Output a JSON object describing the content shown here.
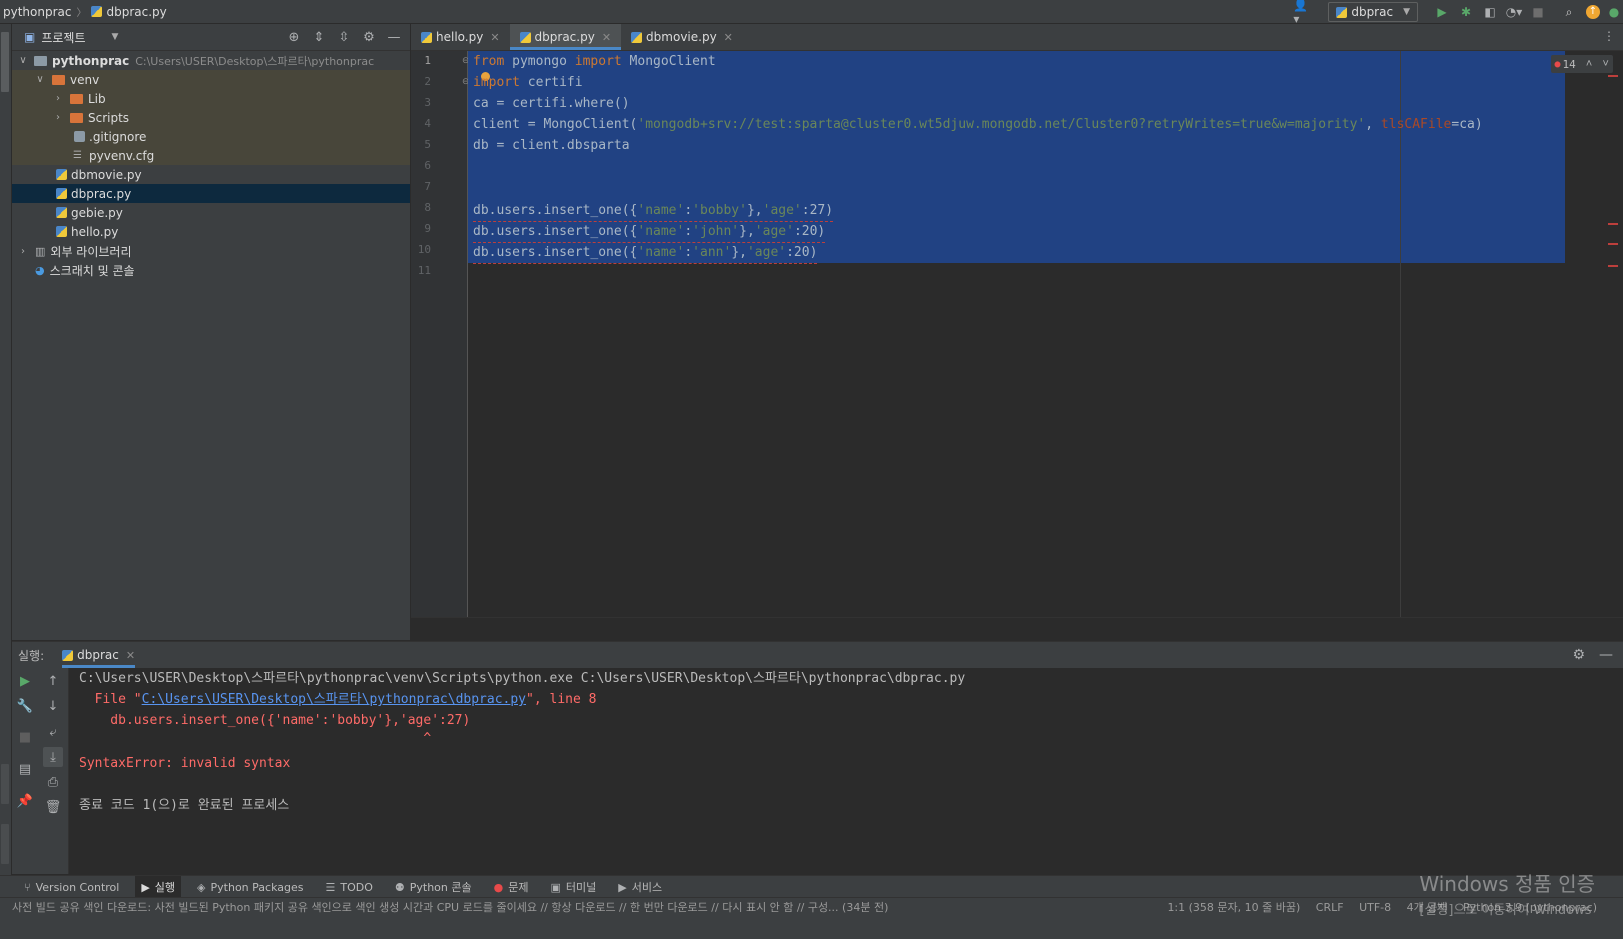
{
  "titlebar": {
    "project": "pythonprac",
    "file": "dbprac.py",
    "run_config": "dbprac"
  },
  "project_pane": {
    "title": "프로젝트",
    "root": {
      "name": "pythonprac",
      "path": "C:\\Users\\USER\\Desktop\\스파르타\\pythonprac"
    },
    "venv": "venv",
    "venv_children": [
      "Lib",
      "Scripts"
    ],
    "venv_files": [
      ".gitignore",
      "pyvenv.cfg"
    ],
    "files": [
      "dbmovie.py",
      "dbprac.py",
      "gebie.py",
      "hello.py"
    ],
    "ext_libs": "외부 라이브러리",
    "scratches": "스크래치 및 콘솔"
  },
  "editor": {
    "tabs": [
      {
        "label": "hello.py"
      },
      {
        "label": "dbprac.py"
      },
      {
        "label": "dbmovie.py"
      }
    ],
    "problem_count": "14",
    "lines": {
      "l1": {
        "a": "from",
        "b": " pymongo ",
        "c": "import",
        "d": " MongoClient"
      },
      "l2": {
        "a": "import",
        "b": " certifi"
      },
      "l3": "ca = certifi.where()",
      "l4": {
        "a": "client = MongoClient(",
        "b": "'mongodb+srv://test:sparta@cluster0.wt5djuw.mongodb.net/Cluster0?retryWrites=true&w=majority'",
        "c": ", ",
        "d": "tlsCAFile",
        "e": "=ca)"
      },
      "l5": "db = client.dbsparta",
      "l8": {
        "a": "db.users.insert_one({",
        "b": "'name'",
        "c": ":",
        "d": "'bobby'",
        "e": "},",
        "f": "'age'",
        "g": ":27)"
      },
      "l9": {
        "a": "db.users.insert_one({",
        "b": "'name'",
        "c": ":",
        "d": "'john'",
        "e": "},",
        "f": "'age'",
        "g": ":20)"
      },
      "l10": {
        "a": "db.users.insert_one({",
        "b": "'name'",
        "c": ":",
        "d": "'ann'",
        "e": "},",
        "f": "'age'",
        "g": ":20)"
      }
    },
    "line_numbers": [
      "1",
      "2",
      "3",
      "4",
      "5",
      "6",
      "7",
      "8",
      "9",
      "10",
      "11"
    ]
  },
  "run_panel": {
    "label": "실행:",
    "tab": "dbprac",
    "console": {
      "cmd": "C:\\Users\\USER\\Desktop\\스파르타\\pythonprac\\venv\\Scripts\\python.exe C:\\Users\\USER\\Desktop\\스파르타\\pythonprac\\dbprac.py",
      "file_prefix": "  File \"",
      "file_link": "C:\\Users\\USER\\Desktop\\스파르타\\pythonprac\\dbprac.py",
      "file_suffix": "\", line 8",
      "code": "    db.users.insert_one({'name':'bobby'},'age':27)",
      "caret": "                                            ^",
      "error": "SyntaxError: invalid syntax",
      "exit": "종료 코드 1(으)로 완료된 프로세스"
    }
  },
  "bottom_tools": [
    {
      "icon": "version-control",
      "label": "Version Control"
    },
    {
      "icon": "run",
      "label": "실행"
    },
    {
      "icon": "python-packages",
      "label": "Python Packages"
    },
    {
      "icon": "todo",
      "label": "TODO"
    },
    {
      "icon": "python-console",
      "label": "Python 콘솔"
    },
    {
      "icon": "problems",
      "label": "문제"
    },
    {
      "icon": "terminal",
      "label": "터미널"
    },
    {
      "icon": "services",
      "label": "서비스"
    }
  ],
  "status": {
    "message": "사전 빌드 공유 색인 다운로드: 사전 빌드된 Python 패키지 공유 색인으로 색인 생성 시간과 CPU 로드를 줄이세요 // 항상 다운로드 // 한 번만 다운로드 // 다시 표시 안 함 // 구성... (34분 전)",
    "position": "1:1 (358 문자, 10 줄 바꿈)",
    "line_sep": "CRLF",
    "encoding": "UTF-8",
    "indent": "4개 공백",
    "interpreter": "Python 3.9 (pythonprac)"
  },
  "watermark": {
    "line1": "Windows 정품 인증",
    "line2": "[설정]으로 이동하여 Windows"
  },
  "colors": {
    "selection": "#214283",
    "keyword": "#cc7832",
    "string": "#6a8759",
    "error": "#ff6b68",
    "link": "#5894f0"
  }
}
